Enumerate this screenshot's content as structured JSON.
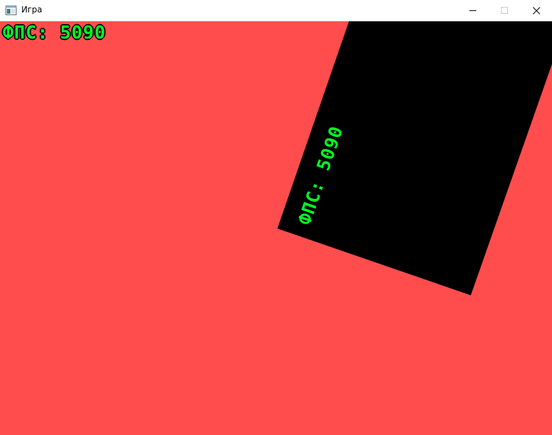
{
  "window": {
    "title": "Игра",
    "icon": "window-app-icon"
  },
  "controls": {
    "minimize_icon": "minimize-icon",
    "maximize_icon": "maximize-icon",
    "close_icon": "close-icon"
  },
  "game": {
    "background_color": "#ff4d4d",
    "rect_color": "#000000",
    "text_color": "#00ff22",
    "fps_label": "ФПС: 5090",
    "fps_rotated_label": "ФПС: 5090"
  }
}
